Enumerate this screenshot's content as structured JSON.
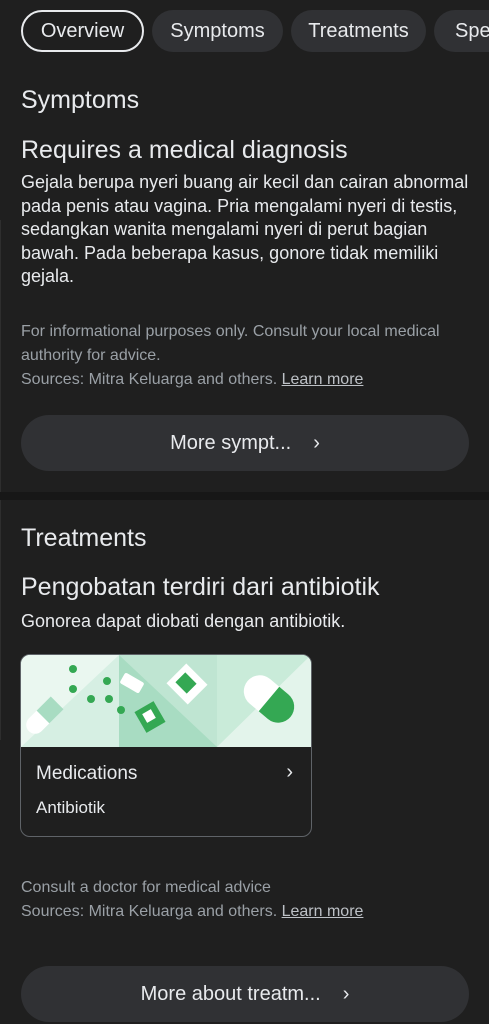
{
  "tabs": [
    {
      "label": "Overview",
      "active": true
    },
    {
      "label": "Symptoms",
      "active": false
    },
    {
      "label": "Treatments",
      "active": false
    },
    {
      "label": "Spe",
      "active": false
    }
  ],
  "symptoms": {
    "section_title": "Symptoms",
    "headline": "Requires a medical diagnosis",
    "description": "Gejala berupa nyeri buang air kecil dan cairan abnormal pada penis atau vagina. Pria mengalami nyeri di testis, sedangkan wanita mengalami nyeri di perut bagian bawah. Pada beberapa kasus, gonore tidak memiliki gejala.",
    "disclaimer": "For informational purposes only. Consult your local medical authority for advice.",
    "sources": "Sources: Mitra Keluarga and others.",
    "learn_more": "Learn more",
    "more_button": "More sympt..."
  },
  "treatments": {
    "section_title": "Treatments",
    "headline": "Pengobatan terdiri dari antibiotik",
    "description": "Gonorea dapat diobati dengan antibiotik.",
    "card": {
      "title": "Medications",
      "subtitle": "Antibiotik"
    },
    "disclaimer": "Consult a doctor for medical advice",
    "sources": "Sources: Mitra Keluarga and others.",
    "learn_more": "Learn more",
    "more_button": "More about treatm..."
  },
  "icons": {
    "chevron": "chevron-right-icon"
  },
  "colors": {
    "background": "#1f1f1f",
    "chip": "#303134",
    "text": "#e8eaed",
    "muted": "#9aa0a6",
    "illus_light": "#d6efe3",
    "illus_mid": "#a8dcc2",
    "illus_green": "#34a853"
  }
}
